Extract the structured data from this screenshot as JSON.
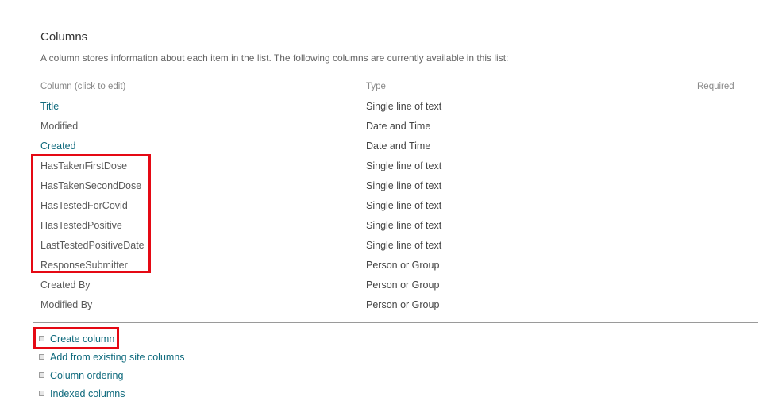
{
  "section": {
    "title": "Columns",
    "description": "A column stores information about each item in the list. The following columns are currently available in this list:"
  },
  "table": {
    "headers": {
      "column": "Column (click to edit)",
      "type": "Type",
      "required": "Required"
    },
    "rows": [
      {
        "name": "Title",
        "type": "Single line of text",
        "required": "",
        "link": true,
        "highlighted": false
      },
      {
        "name": "Modified",
        "type": "Date and Time",
        "required": "",
        "link": false,
        "highlighted": false
      },
      {
        "name": "Created",
        "type": "Date and Time",
        "required": "",
        "link": true,
        "highlighted": false
      },
      {
        "name": "HasTakenFirstDose",
        "type": "Single line of text",
        "required": "",
        "link": false,
        "highlighted": true
      },
      {
        "name": "HasTakenSecondDose",
        "type": "Single line of text",
        "required": "",
        "link": false,
        "highlighted": true
      },
      {
        "name": "HasTestedForCovid",
        "type": "Single line of text",
        "required": "",
        "link": false,
        "highlighted": true
      },
      {
        "name": "HasTestedPositive",
        "type": "Single line of text",
        "required": "",
        "link": false,
        "highlighted": true
      },
      {
        "name": "LastTestedPositiveDate",
        "type": "Single line of text",
        "required": "",
        "link": false,
        "highlighted": true
      },
      {
        "name": "ResponseSubmitter",
        "type": "Person or Group",
        "required": "",
        "link": false,
        "highlighted": true
      },
      {
        "name": "Created By",
        "type": "Person or Group",
        "required": "",
        "link": false,
        "highlighted": false
      },
      {
        "name": "Modified By",
        "type": "Person or Group",
        "required": "",
        "link": false,
        "highlighted": false
      }
    ]
  },
  "actions": [
    {
      "label": "Create column",
      "icon": "bullet-square-icon",
      "highlighted": true
    },
    {
      "label": "Add from existing site columns",
      "icon": "bullet-square-icon",
      "highlighted": false
    },
    {
      "label": "Column ordering",
      "icon": "bullet-square-icon",
      "highlighted": false
    },
    {
      "label": "Indexed columns",
      "icon": "bullet-square-icon",
      "highlighted": false
    }
  ],
  "annotations": {
    "columns_box_color": "#e50914",
    "create_column_box_color": "#e50914"
  },
  "colors": {
    "link": "#0f6a7d",
    "text": "#595959",
    "muted": "#888888",
    "annotation": "#e50914"
  }
}
